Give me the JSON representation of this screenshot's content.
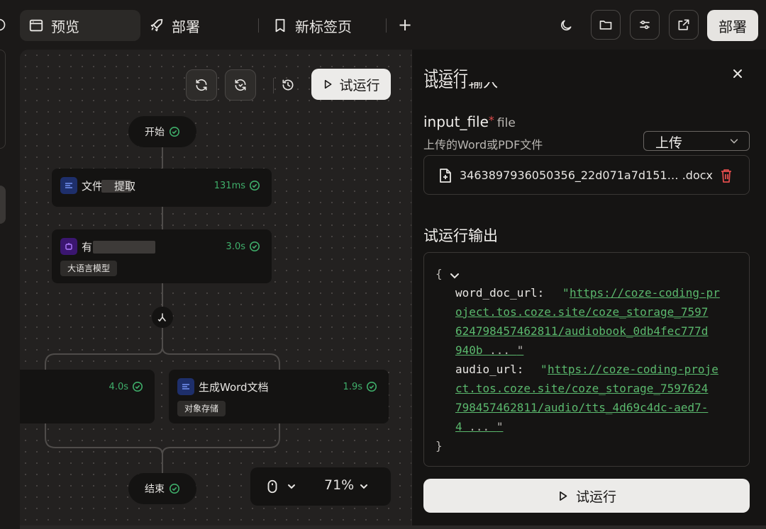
{
  "tabs": [
    {
      "label": "预览",
      "icon": "browser-window-icon",
      "active": true
    },
    {
      "label": "部署",
      "icon": "rocket-icon",
      "active": false
    },
    {
      "label": "新标签页",
      "icon": "bookmark-icon",
      "active": false
    }
  ],
  "topbar": {
    "add_tab": "+",
    "deploy_label": "部署"
  },
  "canvas": {
    "run_label": "试运行",
    "nodes": {
      "start": {
        "label": "开始"
      },
      "end": {
        "label": "结束"
      },
      "node1": {
        "title": "文件",
        "mid": "提取",
        "time": "131ms"
      },
      "node2": {
        "title": "有",
        "time": "3.0s",
        "tag": "大语言模型"
      },
      "node3": {
        "time": "4.0s"
      },
      "node4": {
        "title": "生成Word文档",
        "time": "1.9s",
        "tag": "对象存储"
      }
    },
    "zoom": "71%"
  },
  "panel": {
    "title": "试运行",
    "input_heading": "试运行输入",
    "field": {
      "name": "input_file",
      "required": "*",
      "type": "file",
      "desc": "上传的Word或PDF文件"
    },
    "upload_select": "上传",
    "file_name": "3463897936050356_22d071a7d151… .docx",
    "output_heading": "试运行输出",
    "json": {
      "open": "{",
      "close": "}",
      "k1": "word_doc_url:",
      "v1": [
        "https://coze-coding-pr",
        "oject.tos.coze.site/coze_storage_7597",
        "624798457462811/audiobook_0db4fec777d",
        "940b"
      ],
      "k2": "audio_url:",
      "v2": [
        "https://coze-coding-proje",
        "ct.tos.coze.site/coze_storage_7597624",
        "798457462811/audio/tts_4d69c4dc-aed7-",
        "4"
      ],
      "ellipsis": " ... ",
      "quote": "\""
    },
    "run_label": "试运行"
  },
  "colors": {
    "success": "#3fae6a",
    "link": "#5ab86d",
    "danger": "#e04c4c",
    "accent_blue": "#1e3a8a",
    "accent_purple": "#4c1d95"
  }
}
